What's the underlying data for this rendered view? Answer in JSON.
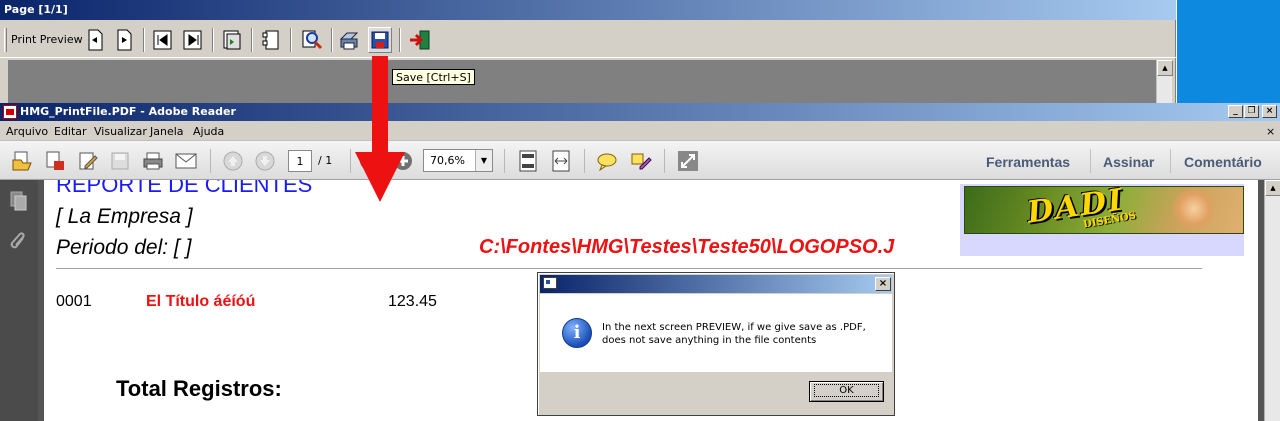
{
  "preview": {
    "title": "Page [1/1]",
    "toolbar_label": "Print Preview",
    "tooltip": "Save [Ctrl+S]",
    "buttons": [
      "prev-page-icon",
      "next-page-icon",
      "first-page-icon",
      "last-page-icon",
      "zoom-icon",
      "page-setup-icon",
      "find-icon",
      "print-icon",
      "save-icon",
      "exit-icon"
    ]
  },
  "reader": {
    "title": "HMG_PrintFile.PDF - Adobe Reader",
    "menu": [
      "Arquivo",
      "Editar",
      "Visualizar",
      "Janela",
      "Ajuda"
    ],
    "menu_close": "×",
    "toolbar": {
      "page_current": "1",
      "page_total": "/ 1",
      "zoom": "70,6%",
      "links": [
        "Ferramentas",
        "Assinar",
        "Comentário"
      ]
    },
    "window_buttons": [
      "_",
      "❐",
      "×"
    ]
  },
  "pdf": {
    "title": "REPORTE DE CLIENTES",
    "company": "[ La Empresa ]",
    "period": "Periodo del:  [  ]",
    "path": "C:\\Fontes\\HMG\\Testes\\Teste50\\LOGOPSO.J",
    "row": {
      "code": "0001",
      "titulo": "El Título   áéíóú",
      "value": "123.45"
    },
    "total": "Total Registros:",
    "logo": {
      "text": "DADI",
      "subtitle": "DISEÑOS"
    }
  },
  "dialog": {
    "message_line1": "In the next screen PREVIEW, if we give save as .PDF,",
    "message_line2": "does not save anything in the file contents",
    "ok_label": "OK",
    "close_label": "×"
  },
  "colors": {
    "title_gradient_start": "#0a246a",
    "title_gradient_end": "#a6caf0",
    "pdf_title": "#1a1aff",
    "pdf_red": "#ee1111",
    "annotation_arrow": "#ee1111",
    "desktop": "#0d8ae0"
  }
}
